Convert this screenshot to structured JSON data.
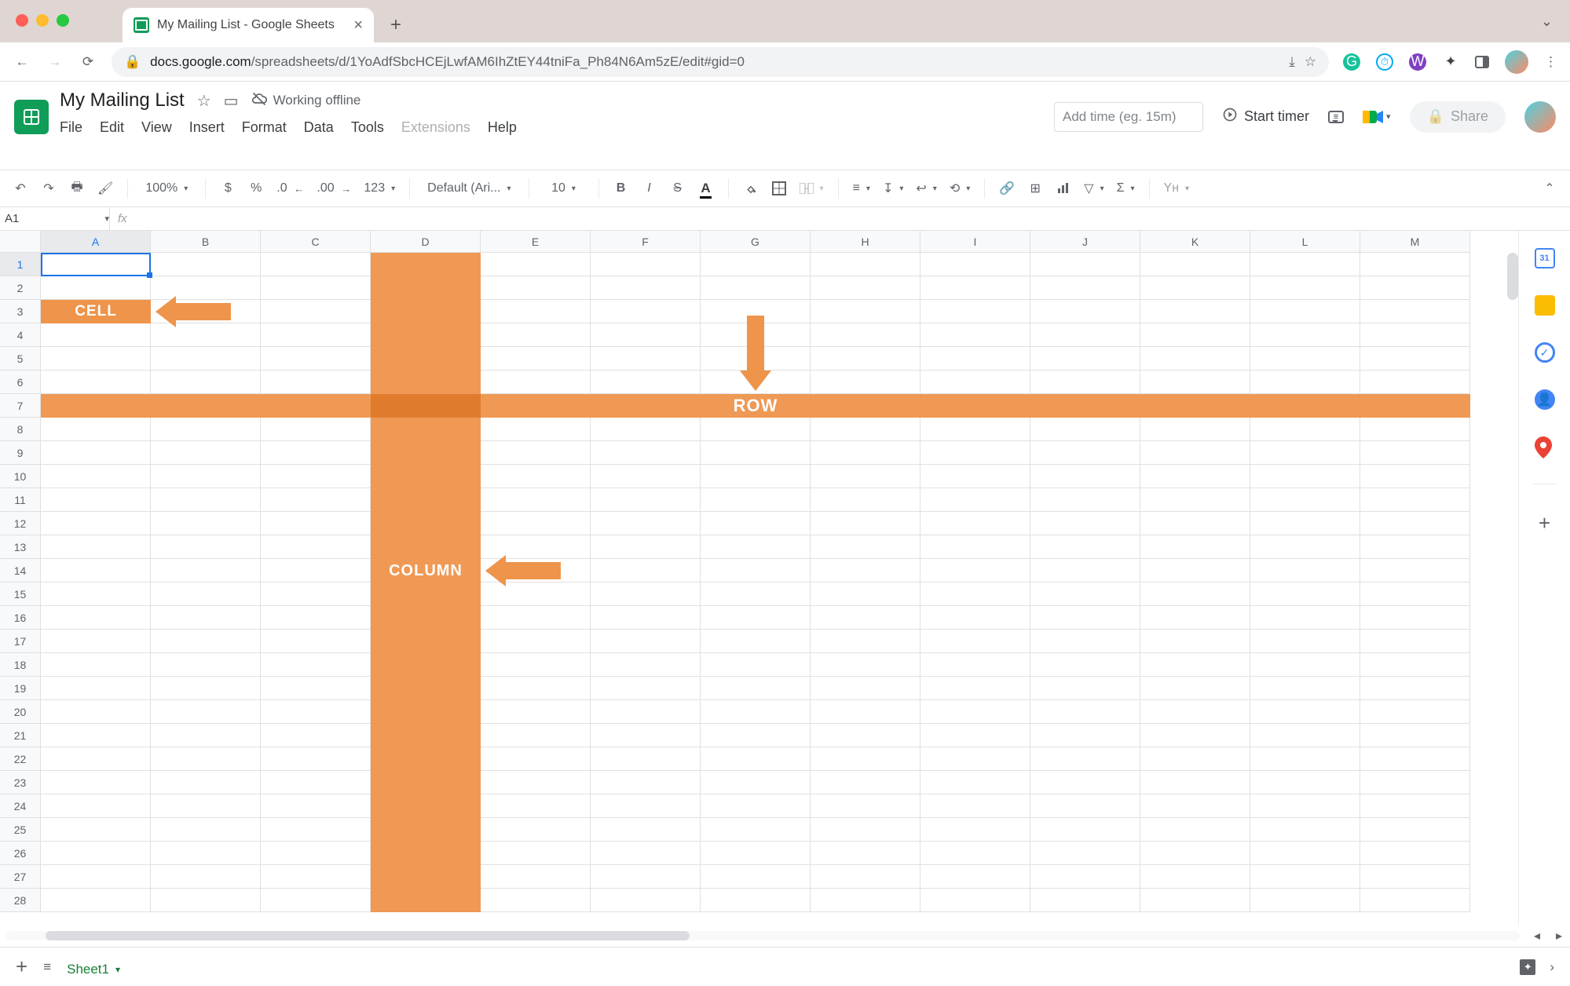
{
  "chrome": {
    "tab_title": "My Mailing List - Google Sheets",
    "url_prefix": "docs.google.com",
    "url_rest": "/spreadsheets/d/1YoAdfSbcHCEjLwfAM6IhZtEY44tniFa_Ph84N6Am5zE/edit#gid=0"
  },
  "doc": {
    "title": "My Mailing List",
    "status": "Working offline"
  },
  "menu": [
    "File",
    "Edit",
    "View",
    "Insert",
    "Format",
    "Data",
    "Tools",
    "Extensions",
    "Help"
  ],
  "timer": {
    "placeholder": "Add time (eg. 15m)",
    "start": "Start timer"
  },
  "share": "Share",
  "toolbar": {
    "zoom": "100%",
    "currency": "$",
    "percent": "%",
    "dec_less": ".0",
    "dec_more": ".00",
    "format123": "123",
    "font": "Default (Ari...",
    "size": "10",
    "bold": "B",
    "italic": "I",
    "strike": "S",
    "textcolor": "A",
    "sigma": "Σ",
    "yh": "Yн"
  },
  "cellref": "A1",
  "columns": [
    "A",
    "B",
    "C",
    "D",
    "E",
    "F",
    "G",
    "H",
    "I",
    "J",
    "K",
    "L",
    "M"
  ],
  "rows": 28,
  "highlight": {
    "col": "D",
    "row": 7,
    "col_start": 1,
    "col_end": 27
  },
  "labels": {
    "cell": "CELL",
    "row": "ROW",
    "column": "COLUMN"
  },
  "sheet_tab": "Sheet1"
}
